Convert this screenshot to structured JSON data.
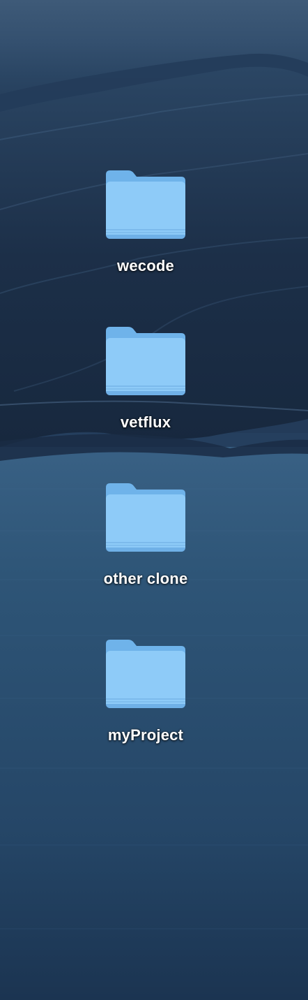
{
  "desktop": {
    "items": [
      {
        "label": "wecode",
        "icon": "folder-icon"
      },
      {
        "label": "vetflux",
        "icon": "folder-icon"
      },
      {
        "label": "other clone",
        "icon": "folder-icon"
      },
      {
        "label": "myProject",
        "icon": "folder-icon"
      }
    ]
  },
  "colors": {
    "folder_body": "#8ecbf8",
    "folder_back": "#6fb3ea",
    "folder_edge": "#5a9fdc",
    "wallpaper_mountains": "#1e324c",
    "wallpaper_sea": "#2c4d6f"
  }
}
